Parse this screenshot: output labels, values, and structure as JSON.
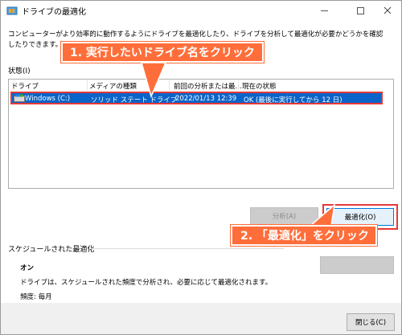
{
  "window": {
    "title": "ドライブの最適化"
  },
  "description": "コンピューターがより効率的に動作するようにドライブを最適化したり、ドライブを分析して最適化が必要かどうかを確認したりできます。ここには、コンピュ",
  "status_label": "状態(I)",
  "table": {
    "columns": [
      "ドライブ",
      "メディアの種類",
      "前回の分析または最...",
      "現在の状態"
    ],
    "rows": [
      {
        "drive": "Windows (C:)",
        "media": "ソリッド ステート ドライブ",
        "last": "2022/01/13 12:39",
        "status": "OK (最後に実行してから 12 日)"
      }
    ]
  },
  "buttons": {
    "analyze": "分析(A)",
    "optimize": "最適化(O)",
    "settings": "",
    "close": "閉じる(C)"
  },
  "schedule": {
    "title": "スケジュールされた最適化",
    "state": "オン",
    "description": "ドライブは、スケジュールされた頻度で分析され、必要に応じて最適化されます。",
    "frequency": "頻度: 毎月"
  },
  "callouts": {
    "step1": "1. 実行したいドライブ名をクリック",
    "step2": "2. 「最適化」をクリック"
  },
  "colors": {
    "accent": "#ff6e3a",
    "highlight": "#e53935",
    "selection": "#0a64c9"
  }
}
